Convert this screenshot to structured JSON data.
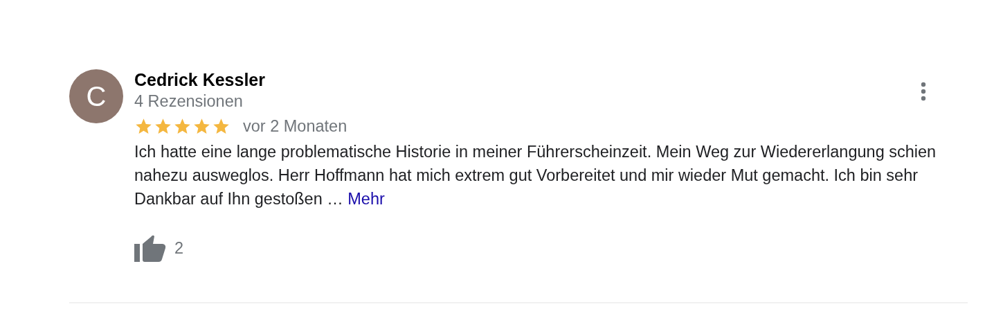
{
  "review": {
    "avatar_letter": "C",
    "author": "Cedrick Kessler",
    "review_count": "4 Rezensionen",
    "stars": 5,
    "time": "vor 2 Monaten",
    "text": "Ich hatte eine lange problematische Historie in meiner Führerscheinzeit. Mein Weg zur Wiedererlangung schien nahezu ausweglos. Herr Hoffmann hat mich extrem gut Vorbereitet und mir wieder Mut gemacht. Ich bin sehr Dankbar auf Ihn gestoßen …",
    "more_link": "Mehr",
    "likes": "2"
  }
}
